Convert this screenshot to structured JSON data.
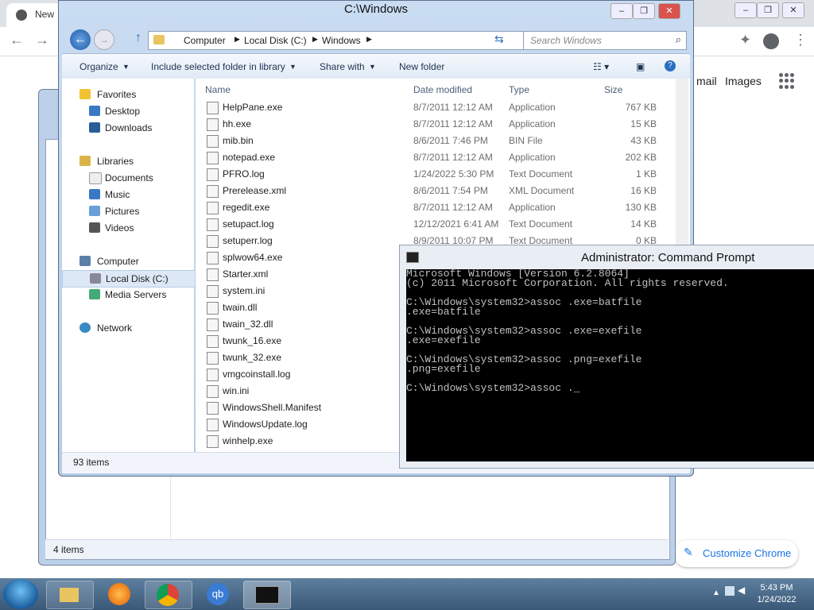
{
  "chrome": {
    "tab_label": "New",
    "links": [
      "mail",
      "Images"
    ],
    "customize_label": "Customize Chrome"
  },
  "explorer_back": {
    "status": "4 items"
  },
  "explorer": {
    "title": "C:\\Windows",
    "breadcrumb": [
      "Computer",
      "Local Disk (C:)",
      "Windows"
    ],
    "search_placeholder": "Search Windows",
    "commands": [
      "Organize",
      "Include selected folder in library",
      "Share with",
      "New folder"
    ],
    "nav": {
      "favorites": "Favorites",
      "desktop": "Desktop",
      "downloads": "Downloads",
      "libraries": "Libraries",
      "documents": "Documents",
      "music": "Music",
      "pictures": "Pictures",
      "videos": "Videos",
      "computer": "Computer",
      "local_disk": "Local Disk (C:)",
      "media_servers": "Media Servers",
      "network": "Network"
    },
    "columns": {
      "name": "Name",
      "date": "Date modified",
      "type": "Type",
      "size": "Size"
    },
    "files": [
      {
        "name": "HelpPane.exe",
        "date": "8/7/2011 12:12 AM",
        "type": "Application",
        "size": "767 KB"
      },
      {
        "name": "hh.exe",
        "date": "8/7/2011 12:12 AM",
        "type": "Application",
        "size": "15 KB"
      },
      {
        "name": "mib.bin",
        "date": "8/6/2011 7:46 PM",
        "type": "BIN File",
        "size": "43 KB"
      },
      {
        "name": "notepad.exe",
        "date": "8/7/2011 12:12 AM",
        "type": "Application",
        "size": "202 KB"
      },
      {
        "name": "PFRO.log",
        "date": "1/24/2022 5:30 PM",
        "type": "Text Document",
        "size": "1 KB"
      },
      {
        "name": "Prerelease.xml",
        "date": "8/6/2011 7:54 PM",
        "type": "XML Document",
        "size": "16 KB"
      },
      {
        "name": "regedit.exe",
        "date": "8/7/2011 12:12 AM",
        "type": "Application",
        "size": "130 KB"
      },
      {
        "name": "setupact.log",
        "date": "12/12/2021 6:41 AM",
        "type": "Text Document",
        "size": "14 KB"
      },
      {
        "name": "setuperr.log",
        "date": "8/9/2011 10:07 PM",
        "type": "Text Document",
        "size": "0 KB"
      },
      {
        "name": "splwow64.exe",
        "date": "",
        "type": "",
        "size": ""
      },
      {
        "name": "Starter.xml",
        "date": "",
        "type": "",
        "size": ""
      },
      {
        "name": "system.ini",
        "date": "",
        "type": "",
        "size": ""
      },
      {
        "name": "twain.dll",
        "date": "",
        "type": "",
        "size": ""
      },
      {
        "name": "twain_32.dll",
        "date": "",
        "type": "",
        "size": ""
      },
      {
        "name": "twunk_16.exe",
        "date": "",
        "type": "",
        "size": ""
      },
      {
        "name": "twunk_32.exe",
        "date": "",
        "type": "",
        "size": ""
      },
      {
        "name": "vmgcoinstall.log",
        "date": "",
        "type": "",
        "size": ""
      },
      {
        "name": "win.ini",
        "date": "",
        "type": "",
        "size": ""
      },
      {
        "name": "WindowsShell.Manifest",
        "date": "",
        "type": "",
        "size": ""
      },
      {
        "name": "WindowsUpdate.log",
        "date": "",
        "type": "",
        "size": ""
      },
      {
        "name": "winhelp.exe",
        "date": "",
        "type": "",
        "size": ""
      }
    ],
    "status": "93 items"
  },
  "cmd": {
    "title": "Administrator: Command Prompt",
    "lines": [
      "Microsoft Windows [Version 6.2.8064]",
      "(c) 2011 Microsoft Corporation. All rights reserved.",
      "",
      "C:\\Windows\\system32>assoc .exe=batfile",
      ".exe=batfile",
      "",
      "C:\\Windows\\system32>assoc .exe=exefile",
      ".exe=exefile",
      "",
      "C:\\Windows\\system32>assoc .png=exefile",
      ".png=exefile",
      "",
      "C:\\Windows\\system32>assoc ._"
    ]
  },
  "taskbar": {
    "time": "5:43 PM",
    "date": "1/24/2022"
  }
}
